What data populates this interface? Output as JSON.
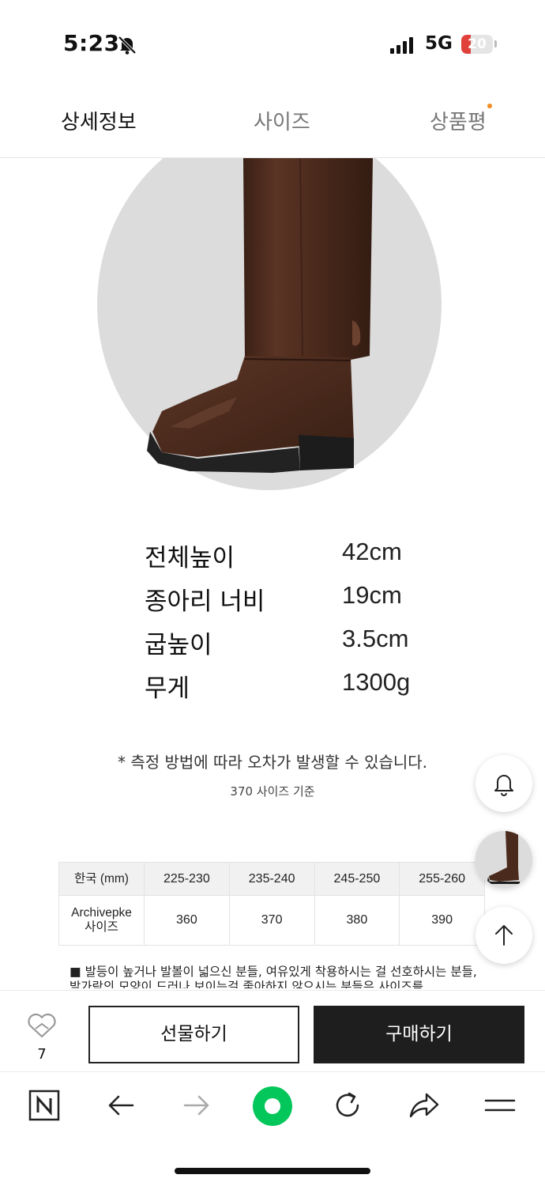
{
  "status_bar": {
    "time": "5:23",
    "network": "5G",
    "battery": "20"
  },
  "tabs": [
    {
      "label": "상세정보"
    },
    {
      "label": "사이즈"
    },
    {
      "label": "상품평"
    }
  ],
  "specs": [
    {
      "label": "전체높이",
      "value": "42cm"
    },
    {
      "label": "종아리 너비",
      "value": "19cm"
    },
    {
      "label": "굽높이",
      "value": "3.5cm"
    },
    {
      "label": "무게",
      "value": "1300g"
    }
  ],
  "note": "* 측정 방법에 따라 오차가 발생할 수 있습니다.",
  "basis": "370 사이즈 기준",
  "size_table": {
    "header": [
      "한국 (mm)",
      "225-230",
      "235-240",
      "245-250",
      "255-260"
    ],
    "row_label_line1": "Archivepke",
    "row_label_line2": "사이즈",
    "row_values": [
      "360",
      "370",
      "380",
      "390"
    ]
  },
  "fit_note": "■ 발등이 높거나 발볼이 넓으신 분들, 여유있게 착용하시는 걸 선호하시는 분들, 발가락의 모양이 드러나 보이는걸 좋아하지 않으시는 분들은 사이즈를",
  "purchase_bar": {
    "wish_count": "7",
    "gift_label": "선물하기",
    "buy_label": "구매하기"
  },
  "colors": {
    "accent_dot": "#f28b20",
    "battery_low": "#e0413b",
    "buy_button": "#1e1e1e",
    "browser_green": "#03c75a",
    "boot_brown": "#4a2a1c"
  },
  "icons": {
    "status": [
      "bell-off-icon",
      "signal-icon",
      "battery-icon"
    ],
    "floating": [
      "bell-icon",
      "product-thumbnail",
      "arrow-up-icon"
    ],
    "browser": [
      "naver-n-icon",
      "back-arrow-icon",
      "forward-arrow-icon",
      "naver-green-button",
      "refresh-icon",
      "share-icon",
      "menu-icon"
    ]
  }
}
